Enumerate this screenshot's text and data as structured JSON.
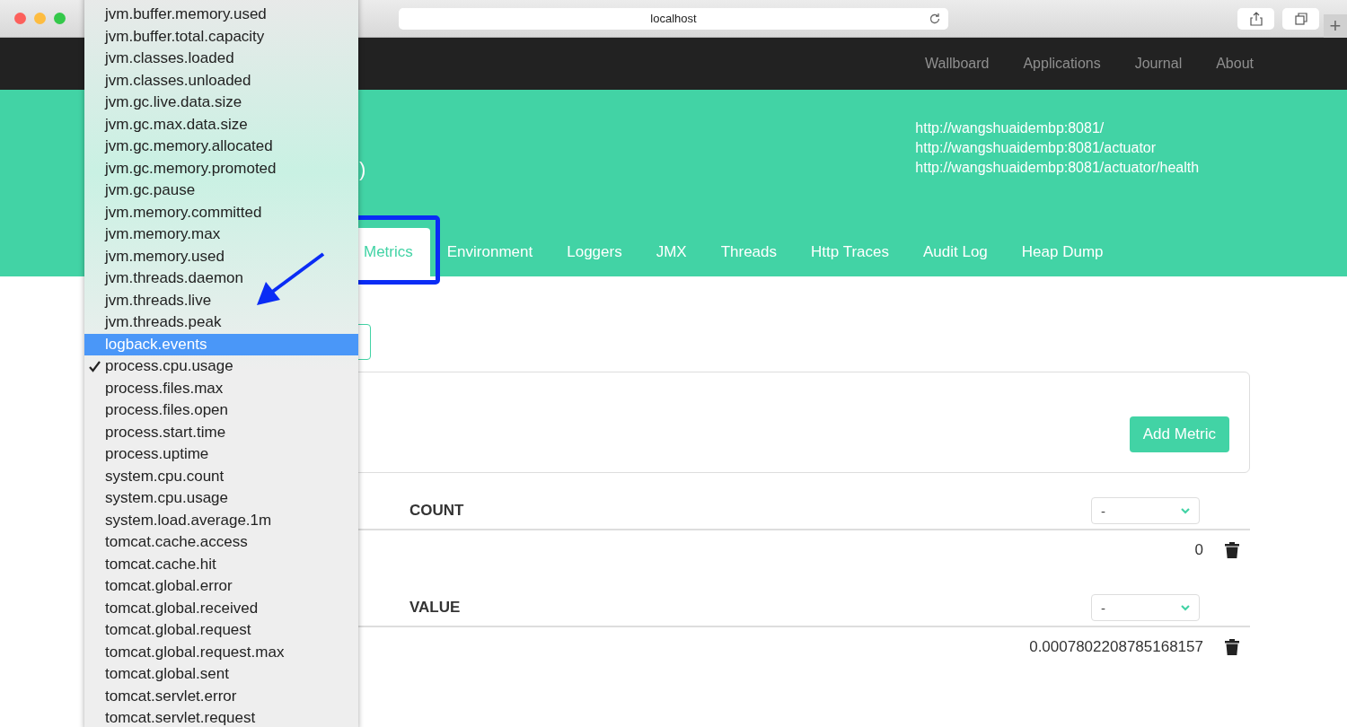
{
  "browser": {
    "address": "localhost",
    "new_tab": "+"
  },
  "nav": {
    "links": [
      "Wallboard",
      "Applications",
      "Journal",
      "About"
    ]
  },
  "header": {
    "title_tail": ")",
    "urls": [
      "http://wangshuaidembp:8081/",
      "http://wangshuaidembp:8081/actuator",
      "http://wangshuaidembp:8081/actuator/health"
    ]
  },
  "tabs": [
    {
      "label": "Metrics",
      "selected": true
    },
    {
      "label": "Environment",
      "selected": false
    },
    {
      "label": "Loggers",
      "selected": false
    },
    {
      "label": "JMX",
      "selected": false
    },
    {
      "label": "Threads",
      "selected": false
    },
    {
      "label": "Http Traces",
      "selected": false
    },
    {
      "label": "Audit Log",
      "selected": false
    },
    {
      "label": "Heap Dump",
      "selected": false
    }
  ],
  "add_metric": "Add Metric",
  "measurements": [
    {
      "heading": "COUNT",
      "unit": "-",
      "value": "0"
    },
    {
      "heading": "VALUE",
      "unit": "-",
      "value": "0.0007802208785168157"
    }
  ],
  "menu": {
    "items": [
      {
        "label": "jvm.buffer.memory.used",
        "selected": false,
        "checked": false
      },
      {
        "label": "jvm.buffer.total.capacity",
        "selected": false,
        "checked": false
      },
      {
        "label": "jvm.classes.loaded",
        "selected": false,
        "checked": false
      },
      {
        "label": "jvm.classes.unloaded",
        "selected": false,
        "checked": false
      },
      {
        "label": "jvm.gc.live.data.size",
        "selected": false,
        "checked": false
      },
      {
        "label": "jvm.gc.max.data.size",
        "selected": false,
        "checked": false
      },
      {
        "label": "jvm.gc.memory.allocated",
        "selected": false,
        "checked": false
      },
      {
        "label": "jvm.gc.memory.promoted",
        "selected": false,
        "checked": false
      },
      {
        "label": "jvm.gc.pause",
        "selected": false,
        "checked": false
      },
      {
        "label": "jvm.memory.committed",
        "selected": false,
        "checked": false
      },
      {
        "label": "jvm.memory.max",
        "selected": false,
        "checked": false
      },
      {
        "label": "jvm.memory.used",
        "selected": false,
        "checked": false
      },
      {
        "label": "jvm.threads.daemon",
        "selected": false,
        "checked": false
      },
      {
        "label": "jvm.threads.live",
        "selected": false,
        "checked": false
      },
      {
        "label": "jvm.threads.peak",
        "selected": false,
        "checked": false
      },
      {
        "label": "logback.events",
        "selected": true,
        "checked": false
      },
      {
        "label": "process.cpu.usage",
        "selected": false,
        "checked": true
      },
      {
        "label": "process.files.max",
        "selected": false,
        "checked": false
      },
      {
        "label": "process.files.open",
        "selected": false,
        "checked": false
      },
      {
        "label": "process.start.time",
        "selected": false,
        "checked": false
      },
      {
        "label": "process.uptime",
        "selected": false,
        "checked": false
      },
      {
        "label": "system.cpu.count",
        "selected": false,
        "checked": false
      },
      {
        "label": "system.cpu.usage",
        "selected": false,
        "checked": false
      },
      {
        "label": "system.load.average.1m",
        "selected": false,
        "checked": false
      },
      {
        "label": "tomcat.cache.access",
        "selected": false,
        "checked": false
      },
      {
        "label": "tomcat.cache.hit",
        "selected": false,
        "checked": false
      },
      {
        "label": "tomcat.global.error",
        "selected": false,
        "checked": false
      },
      {
        "label": "tomcat.global.received",
        "selected": false,
        "checked": false
      },
      {
        "label": "tomcat.global.request",
        "selected": false,
        "checked": false
      },
      {
        "label": "tomcat.global.request.max",
        "selected": false,
        "checked": false
      },
      {
        "label": "tomcat.global.sent",
        "selected": false,
        "checked": false
      },
      {
        "label": "tomcat.servlet.error",
        "selected": false,
        "checked": false
      },
      {
        "label": "tomcat.servlet.request",
        "selected": false,
        "checked": false
      }
    ]
  }
}
